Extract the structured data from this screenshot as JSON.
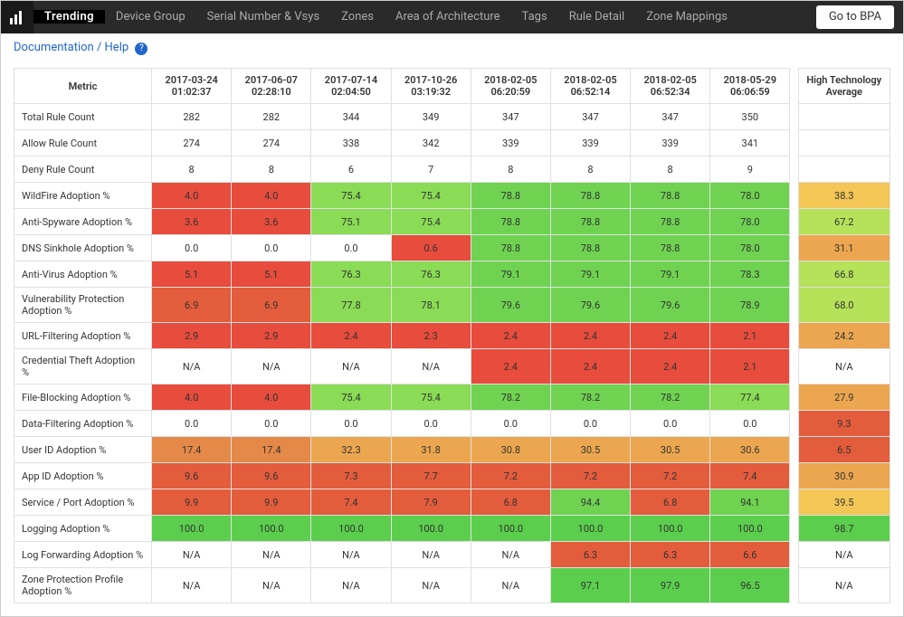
{
  "nav": {
    "items": [
      "Trending",
      "Device Group",
      "Serial Number & Vsys",
      "Zones",
      "Area of Architecture",
      "Tags",
      "Rule Detail",
      "Zone Mappings"
    ],
    "active": 0,
    "bpa": "Go to BPA"
  },
  "doc_link": "Documentation / Help",
  "headers": {
    "metric": "Metric",
    "cols": [
      {
        "d": "2017-03-24",
        "t": "01:02:37"
      },
      {
        "d": "2017-06-07",
        "t": "02:28:10"
      },
      {
        "d": "2017-07-14",
        "t": "02:04:50"
      },
      {
        "d": "2017-10-26",
        "t": "03:19:32"
      },
      {
        "d": "2018-02-05",
        "t": "06:20:59"
      },
      {
        "d": "2018-02-05",
        "t": "06:52:14"
      },
      {
        "d": "2018-02-05",
        "t": "06:52:34"
      },
      {
        "d": "2018-05-29",
        "t": "06:06:59"
      }
    ],
    "hta": "High Technology Average"
  },
  "rows": [
    {
      "m": "Total Rule Count",
      "v": [
        "282",
        "282",
        "344",
        "349",
        "347",
        "347",
        "347",
        "350"
      ],
      "c": [
        "plain",
        "plain",
        "plain",
        "plain",
        "plain",
        "plain",
        "plain",
        "plain"
      ],
      "hv": "",
      "hc": "plain"
    },
    {
      "m": "Allow Rule Count",
      "v": [
        "274",
        "274",
        "338",
        "342",
        "339",
        "339",
        "339",
        "341"
      ],
      "c": [
        "plain",
        "plain",
        "plain",
        "plain",
        "plain",
        "plain",
        "plain",
        "plain"
      ],
      "hv": "",
      "hc": "plain"
    },
    {
      "m": "Deny Rule Count",
      "v": [
        "8",
        "8",
        "6",
        "7",
        "8",
        "8",
        "8",
        "9"
      ],
      "c": [
        "plain",
        "plain",
        "plain",
        "plain",
        "plain",
        "plain",
        "plain",
        "plain"
      ],
      "hv": "",
      "hc": "plain"
    },
    {
      "m": "WildFire Adoption %",
      "v": [
        "4.0",
        "4.0",
        "75.4",
        "75.4",
        "78.8",
        "78.8",
        "78.8",
        "78.0"
      ],
      "c": [
        "c-r1",
        "c-r1",
        "c-g2",
        "c-g2",
        "c-g3",
        "c-g3",
        "c-g3",
        "c-g3"
      ],
      "hv": "38.3",
      "hc": "c-y1"
    },
    {
      "m": "Anti-Spyware Adoption %",
      "v": [
        "3.6",
        "3.6",
        "75.1",
        "75.4",
        "78.8",
        "78.8",
        "78.8",
        "78.0"
      ],
      "c": [
        "c-r1",
        "c-r1",
        "c-g2",
        "c-g2",
        "c-g3",
        "c-g3",
        "c-g3",
        "c-g3"
      ],
      "hv": "67.2",
      "hc": "c-g1"
    },
    {
      "m": "DNS Sinkhole Adoption %",
      "v": [
        "0.0",
        "0.0",
        "0.0",
        "0.6",
        "78.8",
        "78.8",
        "78.8",
        "78.0"
      ],
      "c": [
        "plain",
        "plain",
        "plain",
        "c-r1",
        "c-g3",
        "c-g3",
        "c-g3",
        "c-g3"
      ],
      "hv": "31.1",
      "hc": "c-o2"
    },
    {
      "m": "Anti-Virus Adoption %",
      "v": [
        "5.1",
        "5.1",
        "76.3",
        "76.3",
        "79.1",
        "79.1",
        "79.1",
        "78.3"
      ],
      "c": [
        "c-r1",
        "c-r1",
        "c-g2",
        "c-g2",
        "c-g3",
        "c-g3",
        "c-g3",
        "c-g3"
      ],
      "hv": "66.8",
      "hc": "c-g1"
    },
    {
      "m": "Vulnerability Protection Adoption %",
      "v": [
        "6.9",
        "6.9",
        "77.8",
        "78.1",
        "79.6",
        "79.6",
        "79.6",
        "78.9"
      ],
      "c": [
        "c-r2",
        "c-r2",
        "c-g2",
        "c-g2",
        "c-g3",
        "c-g3",
        "c-g3",
        "c-g3"
      ],
      "hv": "68.0",
      "hc": "c-g1"
    },
    {
      "m": "URL-Filtering Adoption %",
      "v": [
        "2.9",
        "2.9",
        "2.4",
        "2.3",
        "2.4",
        "2.4",
        "2.4",
        "2.1"
      ],
      "c": [
        "c-r1",
        "c-r1",
        "c-r1",
        "c-r1",
        "c-r1",
        "c-r1",
        "c-r1",
        "c-r1"
      ],
      "hv": "24.2",
      "hc": "c-o2"
    },
    {
      "m": "Credential Theft Adoption %",
      "v": [
        "N/A",
        "N/A",
        "N/A",
        "N/A",
        "2.4",
        "2.4",
        "2.4",
        "2.1"
      ],
      "c": [
        "plain",
        "plain",
        "plain",
        "plain",
        "c-r1",
        "c-r1",
        "c-r1",
        "c-r1"
      ],
      "hv": "N/A",
      "hc": "plain"
    },
    {
      "m": "File-Blocking Adoption %",
      "v": [
        "4.0",
        "4.0",
        "75.4",
        "75.4",
        "78.2",
        "78.2",
        "78.2",
        "77.4"
      ],
      "c": [
        "c-r1",
        "c-r1",
        "c-g2",
        "c-g2",
        "c-g3",
        "c-g3",
        "c-g3",
        "c-g2"
      ],
      "hv": "27.9",
      "hc": "c-o2"
    },
    {
      "m": "Data-Filtering Adoption %",
      "v": [
        "0.0",
        "0.0",
        "0.0",
        "0.0",
        "0.0",
        "0.0",
        "0.0",
        "0.0"
      ],
      "c": [
        "plain",
        "plain",
        "plain",
        "plain",
        "plain",
        "plain",
        "plain",
        "plain"
      ],
      "hv": "9.3",
      "hc": "c-r2"
    },
    {
      "m": "User ID Adoption %",
      "v": [
        "17.4",
        "17.4",
        "32.3",
        "31.8",
        "30.8",
        "30.5",
        "30.5",
        "30.6"
      ],
      "c": [
        "c-o1",
        "c-o1",
        "c-o2",
        "c-o2",
        "c-o2",
        "c-o2",
        "c-o2",
        "c-o2"
      ],
      "hv": "6.5",
      "hc": "c-r2"
    },
    {
      "m": "App ID Adoption %",
      "v": [
        "9.6",
        "9.6",
        "7.3",
        "7.7",
        "7.2",
        "7.2",
        "7.2",
        "7.4"
      ],
      "c": [
        "c-r2",
        "c-r2",
        "c-r2",
        "c-r2",
        "c-r2",
        "c-r2",
        "c-r2",
        "c-r2"
      ],
      "hv": "30.9",
      "hc": "c-o2"
    },
    {
      "m": "Service / Port Adoption %",
      "v": [
        "9.9",
        "9.9",
        "7.4",
        "7.9",
        "6.8",
        "94.4",
        "6.8",
        "94.1"
      ],
      "c": [
        "c-r2",
        "c-r2",
        "c-r2",
        "c-r2",
        "c-r2",
        "c-g3",
        "c-r2",
        "c-g3"
      ],
      "hv": "39.5",
      "hc": "c-y1"
    },
    {
      "m": "Logging Adoption %",
      "v": [
        "100.0",
        "100.0",
        "100.0",
        "100.0",
        "100.0",
        "100.0",
        "100.0",
        "100.0"
      ],
      "c": [
        "c-g4",
        "c-g4",
        "c-g4",
        "c-g4",
        "c-g4",
        "c-g4",
        "c-g4",
        "c-g4"
      ],
      "hv": "98.7",
      "hc": "c-g4"
    },
    {
      "m": "Log Forwarding Adoption %",
      "v": [
        "N/A",
        "N/A",
        "N/A",
        "N/A",
        "N/A",
        "6.3",
        "6.3",
        "6.6"
      ],
      "c": [
        "plain",
        "plain",
        "plain",
        "plain",
        "plain",
        "c-r2",
        "c-r2",
        "c-r2"
      ],
      "hv": "N/A",
      "hc": "plain"
    },
    {
      "m": "Zone Protection Profile Adoption %",
      "v": [
        "N/A",
        "N/A",
        "N/A",
        "N/A",
        "N/A",
        "97.1",
        "97.9",
        "96.5"
      ],
      "c": [
        "plain",
        "plain",
        "plain",
        "plain",
        "plain",
        "c-g4",
        "c-g4",
        "c-g4"
      ],
      "hv": "N/A",
      "hc": "plain"
    }
  ]
}
